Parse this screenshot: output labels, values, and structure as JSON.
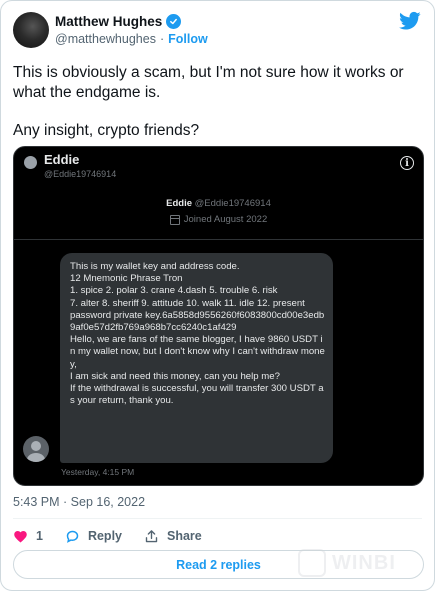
{
  "author": {
    "name": "Matthew Hughes",
    "handle": "@matthewhughes",
    "separator": "·",
    "follow_label": "Follow"
  },
  "tweet": {
    "paragraphs": [
      "This is obviously a scam, but I'm not sure how it works or what the endgame is.",
      "Any insight, crypto friends?"
    ]
  },
  "embed": {
    "profile_name": "Eddie",
    "profile_handle": "@Eddie19746914",
    "center_name": "Eddie",
    "center_handle": "@Eddie19746914",
    "joined": "Joined August 2022",
    "info_glyph": "i",
    "message_lines": [
      "This is my wallet key and address code.",
      "12 Mnemonic Phrase Tron",
      "1. spice  2. polar  3. crane  4.dash  5. trouble  6. risk",
      "7. alter  8. sheriff  9. attitude  10. walk  11. idle  12. present",
      "password private key.6a5858d9556260f6083800cd00e3edb9af0e57d2fb769a968b7cc6240c1af429",
      "Hello, we are fans of the same blogger, I have 9860 USDT in my wallet now, but I don't know why I can't withdraw money,",
      "I am sick and need this money, can you help me?",
      "If the withdrawal is successful, you will transfer 300 USDT as your return, thank you."
    ],
    "message_time": "Yesterday, 4:15 PM"
  },
  "meta": {
    "timestamp": "5:43 PM · Sep 16, 2022"
  },
  "actions": {
    "like_count": "1",
    "reply_label": "Reply",
    "share_label": "Share",
    "read_replies_label": "Read 2 replies"
  },
  "watermark": {
    "text": "WINBI"
  },
  "colors": {
    "accent": "#1d9bf0",
    "like": "#f91880",
    "embed_bg": "#000000",
    "bubble_bg": "#2f3336"
  }
}
